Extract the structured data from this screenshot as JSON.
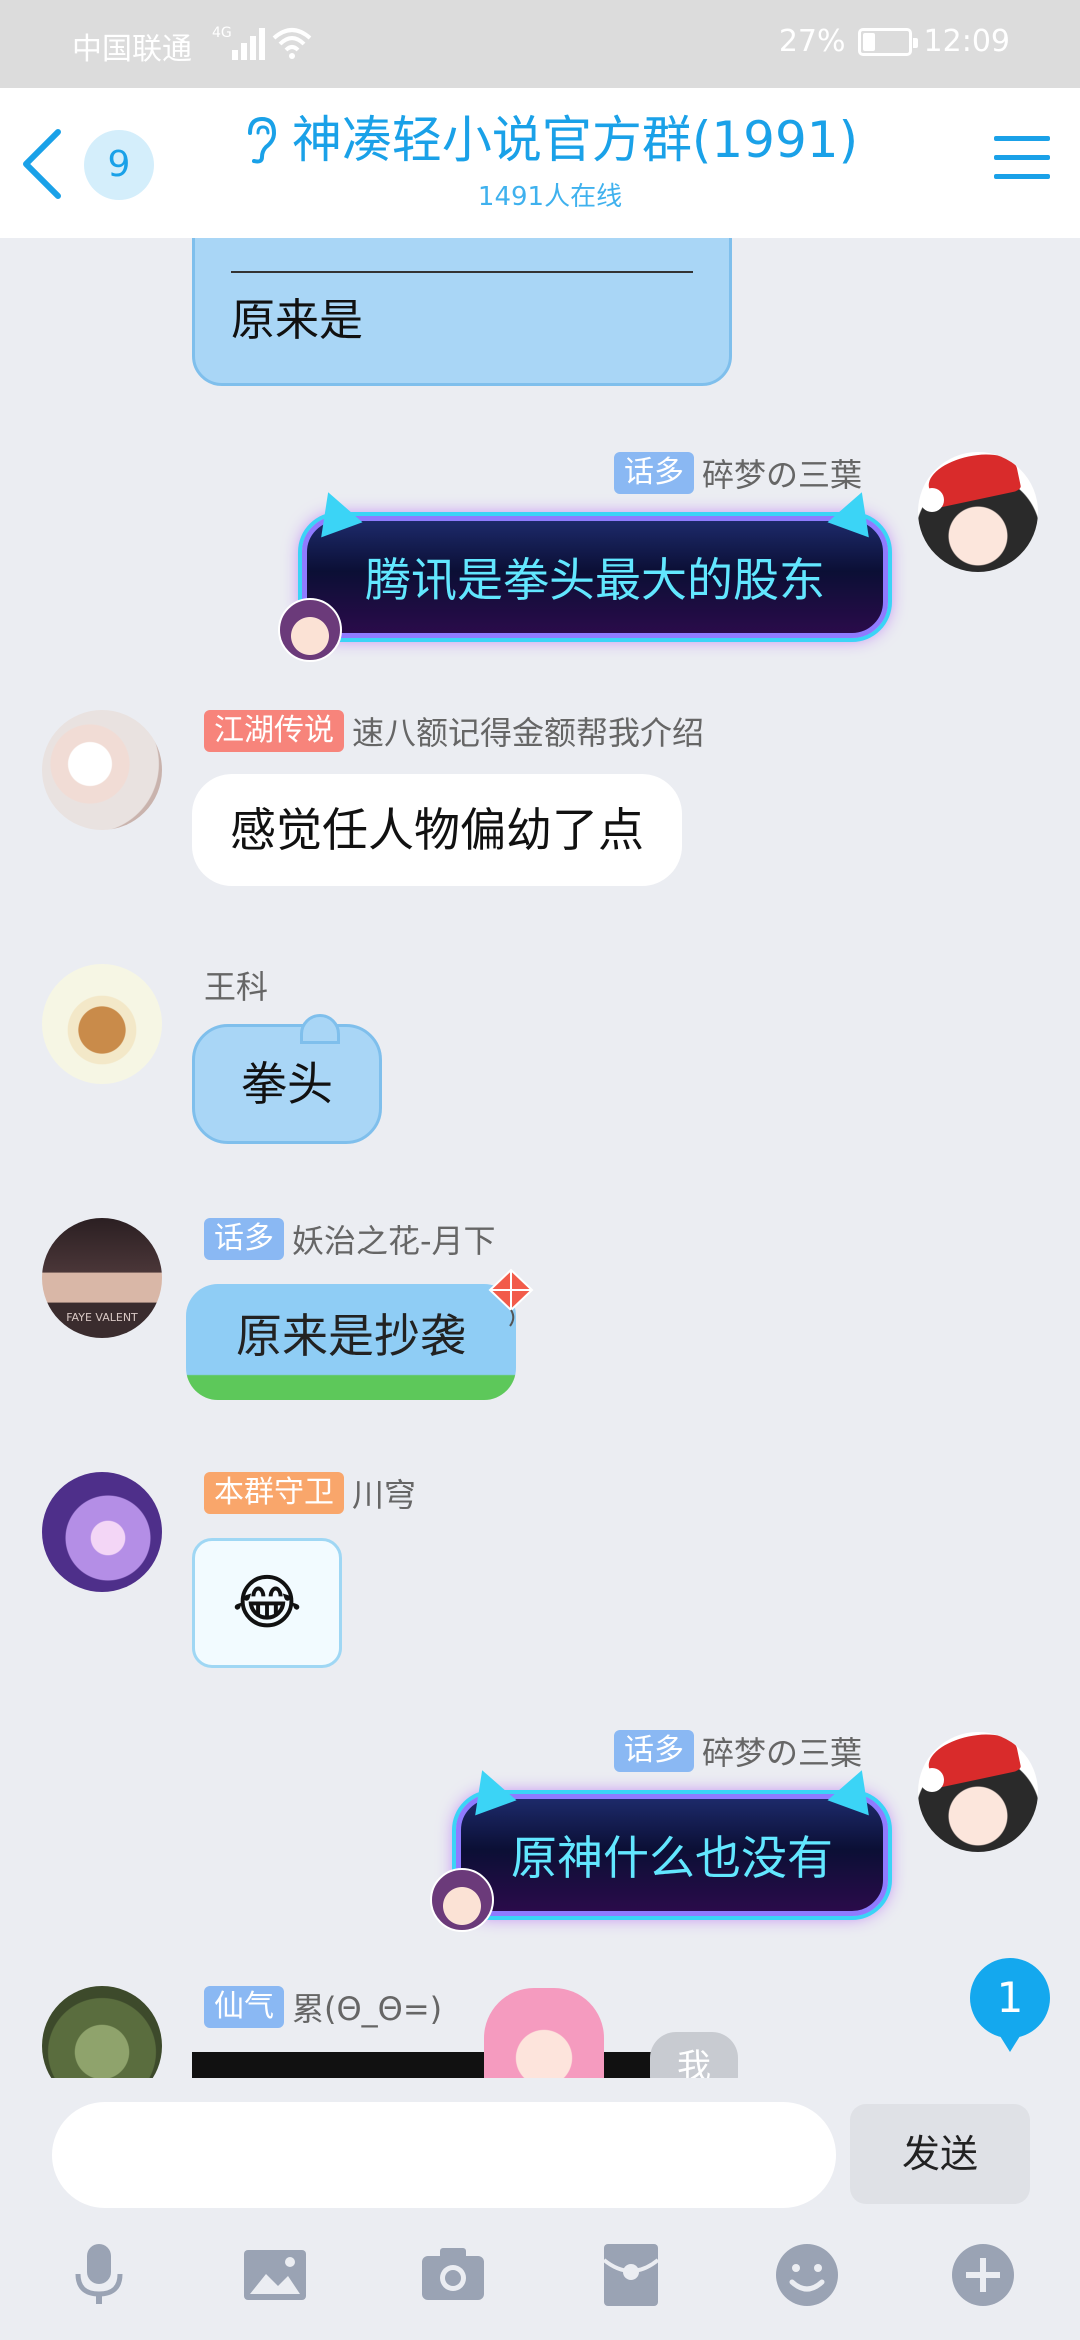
{
  "status_bar": {
    "carrier": "中国联通",
    "network": "4G",
    "battery": "27%",
    "battery_level": 0.27,
    "time": "12:09"
  },
  "header": {
    "unread_count": "9",
    "group_name": "神凑轻小说官方群(1991)",
    "online_count": "1491人在线"
  },
  "messages": [
    {
      "type": "quoted_reply",
      "text": "原来是"
    },
    {
      "side": "right",
      "tag": "话多",
      "tag_color": "#8ab8f3",
      "sender": "碎梦の三葉",
      "text": "腾讯是拳头最大的股东",
      "bubble": "neon"
    },
    {
      "side": "left",
      "tag": "江湖传说",
      "tag_color": "#f7847b",
      "sender": "速八额记得金额帮我介绍",
      "text": "感觉任人物偏幼了点",
      "bubble": "white"
    },
    {
      "side": "left",
      "tag": "",
      "sender": "王科",
      "text": "拳头",
      "bubble": "cloud"
    },
    {
      "side": "left",
      "tag": "话多",
      "tag_color": "#8ab8f3",
      "sender": "妖治之花-月下",
      "text": "原来是抄袭",
      "bubble": "kite",
      "avatar_caption": "FAYE VALENT"
    },
    {
      "side": "left",
      "tag": "本群守卫",
      "tag_color": "#f9a66b",
      "sender": "川穹",
      "text": "😂",
      "bubble": "card"
    },
    {
      "side": "right",
      "tag": "话多",
      "tag_color": "#8ab8f3",
      "sender": "碎梦の三葉",
      "text": "原神什么也没有",
      "bubble": "neon"
    },
    {
      "side": "left",
      "tag": "仙气",
      "tag_color": "#8ab8f3",
      "sender": "累(Θ_Θ=)",
      "text": "我",
      "bubble": "partial"
    }
  ],
  "new_message_badge": "1",
  "input": {
    "placeholder": "",
    "send_label": "发送"
  },
  "toolbar": [
    "microphone-icon",
    "image-icon",
    "camera-icon",
    "red-packet-icon",
    "emoji-icon",
    "plus-icon"
  ]
}
